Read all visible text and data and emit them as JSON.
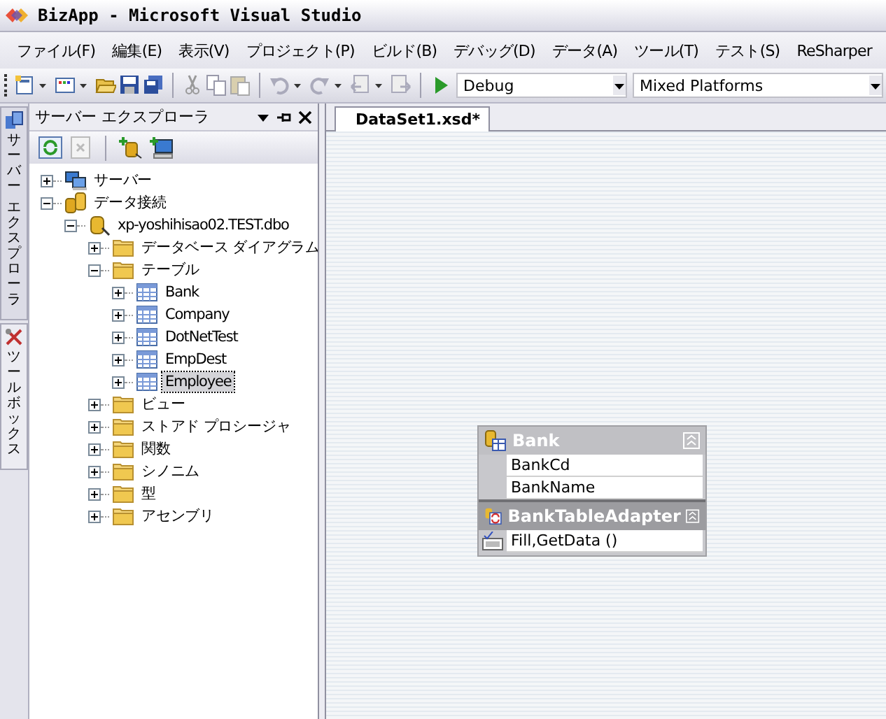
{
  "window": {
    "title": "BizApp - Microsoft Visual Studio"
  },
  "menu": [
    "ファイル(F)",
    "編集(E)",
    "表示(V)",
    "プロジェクト(P)",
    "ビルド(B)",
    "デバッグ(D)",
    "データ(A)",
    "ツール(T)",
    "テスト(S)",
    "ReSharper"
  ],
  "toolbar": {
    "configuration": "Debug",
    "platform": "Mixed Platforms"
  },
  "side_tabs": [
    {
      "label": [
        "サーバー",
        "エクスプローラ"
      ],
      "selected": true
    },
    {
      "label": [
        "ツールボックス"
      ],
      "selected": false
    }
  ],
  "server_explorer": {
    "title": "サーバー エクスプローラ",
    "tree": [
      {
        "label": "サーバー",
        "kind": "servers",
        "expanded": false,
        "selected": false
      },
      {
        "label": "データ接続",
        "kind": "connections",
        "expanded": true,
        "selected": false,
        "children": [
          {
            "label": "xp-yoshihisao02.TEST.dbo",
            "kind": "database",
            "expanded": true,
            "selected": false,
            "children": [
              {
                "label": "データベース ダイアグラム",
                "kind": "folder",
                "expanded": false,
                "selected": false
              },
              {
                "label": "テーブル",
                "kind": "folder",
                "expanded": true,
                "selected": false,
                "children": [
                  {
                    "label": "Bank",
                    "kind": "table",
                    "expanded": false,
                    "selected": false
                  },
                  {
                    "label": "Company",
                    "kind": "table",
                    "expanded": false,
                    "selected": false
                  },
                  {
                    "label": "DotNetTest",
                    "kind": "table",
                    "expanded": false,
                    "selected": false
                  },
                  {
                    "label": "EmpDest",
                    "kind": "table",
                    "expanded": false,
                    "selected": false
                  },
                  {
                    "label": "Employee",
                    "kind": "table",
                    "expanded": false,
                    "selected": true
                  }
                ]
              },
              {
                "label": "ビュー",
                "kind": "folder",
                "expanded": false,
                "selected": false
              },
              {
                "label": "ストアド プロシージャ",
                "kind": "folder",
                "expanded": false,
                "selected": false
              },
              {
                "label": "関数",
                "kind": "folder",
                "expanded": false,
                "selected": false
              },
              {
                "label": "シノニム",
                "kind": "folder",
                "expanded": false,
                "selected": false
              },
              {
                "label": "型",
                "kind": "folder",
                "expanded": false,
                "selected": false
              },
              {
                "label": "アセンブリ",
                "kind": "folder",
                "expanded": false,
                "selected": false
              }
            ]
          }
        ]
      }
    ]
  },
  "document_tabs": [
    {
      "label": "DataSet1.xsd*",
      "selected": true
    }
  ],
  "designer": {
    "table": {
      "name": "Bank",
      "columns": [
        "BankCd",
        "BankName"
      ]
    },
    "adapter": {
      "name": "BankTableAdapter",
      "methods": [
        "Fill,GetData ()"
      ]
    }
  }
}
